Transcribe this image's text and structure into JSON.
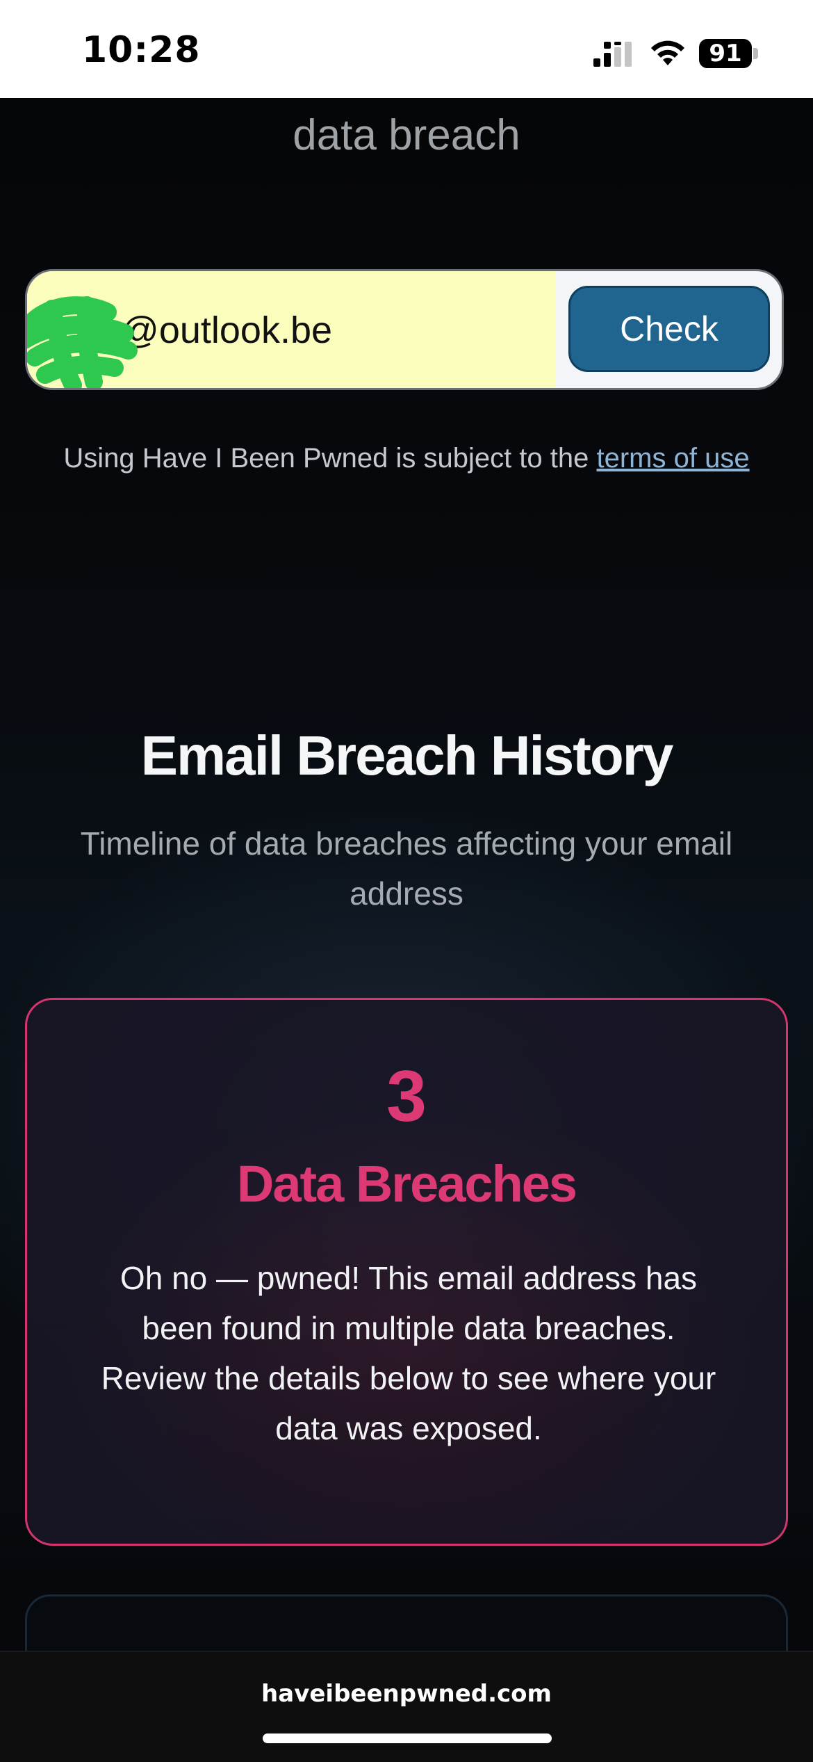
{
  "status_bar": {
    "time": "10:28",
    "battery": "91",
    "icons": [
      "signal-icon",
      "wifi-icon",
      "battery-icon"
    ]
  },
  "page": {
    "subtitle": "data breach"
  },
  "search": {
    "email_value": "@outlook.be",
    "check_label": "Check"
  },
  "terms": {
    "prefix": "Using Have I Been Pwned is subject to the ",
    "link_text": "terms of use"
  },
  "history": {
    "title": "Email Breach History",
    "description": "Timeline of data breaches affecting your email address"
  },
  "breach_card": {
    "count": "3",
    "label": "Data Breaches",
    "message": "Oh no — pwned! This email address has been found in multiple data breaches. Review the details below to see where your data was exposed."
  },
  "browser": {
    "url": "haveibeenpwned.com"
  },
  "colors": {
    "accent_pink": "#dd3a75",
    "button_blue": "#1f6590",
    "email_field_bg": "#fafdbb",
    "link_blue": "#8fb5d6"
  }
}
